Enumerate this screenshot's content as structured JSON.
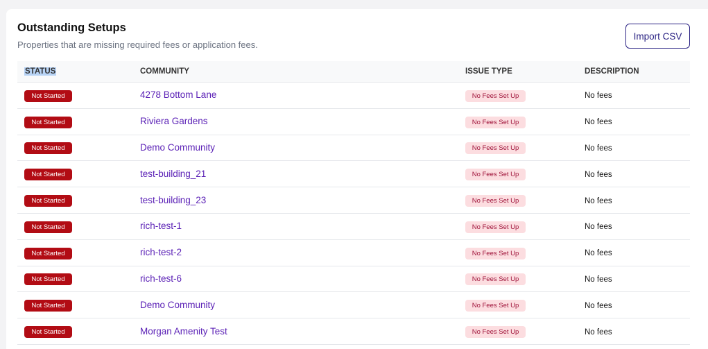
{
  "header": {
    "title": "Outstanding Setups",
    "subtitle": "Properties that are missing required fees or application fees.",
    "import_label": "Import CSV"
  },
  "table": {
    "columns": [
      "STATUS",
      "COMMUNITY",
      "ISSUE TYPE",
      "DESCRIPTION"
    ],
    "rows": [
      {
        "status": "Not Started",
        "community": "4278 Bottom Lane",
        "issue": "No Fees Set Up",
        "description": "No fees"
      },
      {
        "status": "Not Started",
        "community": "Riviera Gardens",
        "issue": "No Fees Set Up",
        "description": "No fees"
      },
      {
        "status": "Not Started",
        "community": "Demo Community",
        "issue": "No Fees Set Up",
        "description": "No fees"
      },
      {
        "status": "Not Started",
        "community": "test-building_21",
        "issue": "No Fees Set Up",
        "description": "No fees"
      },
      {
        "status": "Not Started",
        "community": "test-building_23",
        "issue": "No Fees Set Up",
        "description": "No fees"
      },
      {
        "status": "Not Started",
        "community": "rich-test-1",
        "issue": "No Fees Set Up",
        "description": "No fees"
      },
      {
        "status": "Not Started",
        "community": "rich-test-2",
        "issue": "No Fees Set Up",
        "description": "No fees"
      },
      {
        "status": "Not Started",
        "community": "rich-test-6",
        "issue": "No Fees Set Up",
        "description": "No fees"
      },
      {
        "status": "Not Started",
        "community": "Demo Community",
        "issue": "No Fees Set Up",
        "description": "No fees"
      },
      {
        "status": "Not Started",
        "community": "Morgan Amenity Test",
        "issue": "No Fees Set Up",
        "description": "No fees"
      }
    ]
  },
  "colors": {
    "status_badge": "#b20c14",
    "issue_badge_bg": "#fcdde0",
    "issue_badge_text": "#9f1239",
    "link": "#5b21b6",
    "button_border": "#2a2283",
    "selection_highlight": "#b7d3f5"
  }
}
